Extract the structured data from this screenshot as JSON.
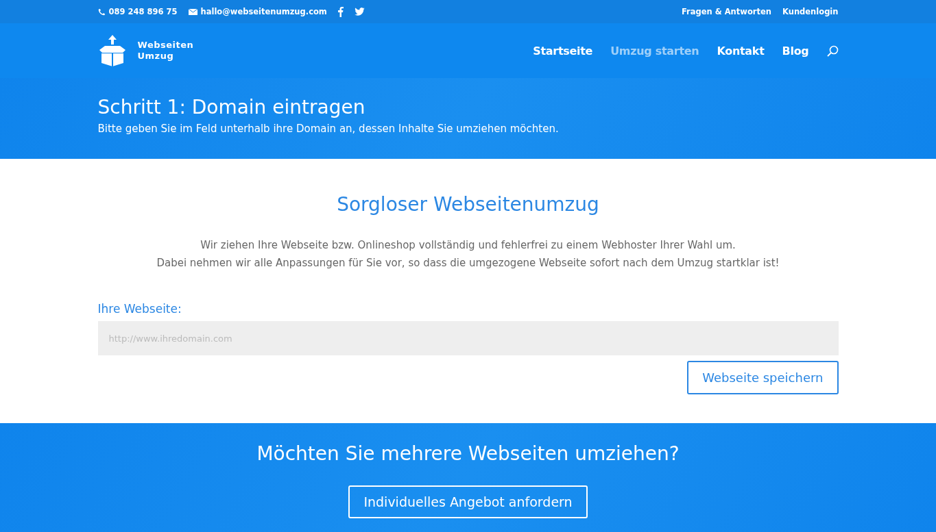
{
  "top_bar": {
    "phone": "089 248 896 75",
    "email": "hallo@webseitenumzug.com",
    "links": [
      "Fragen & Antworten",
      "Kundenlogin"
    ]
  },
  "header": {
    "logo_text": [
      "Webseiten",
      "Umzug"
    ],
    "nav": [
      {
        "label": "Startseite",
        "selected": false
      },
      {
        "label": "Umzug starten",
        "selected": true
      },
      {
        "label": "Kontakt",
        "selected": false
      },
      {
        "label": "Blog",
        "selected": false
      }
    ]
  },
  "hero": {
    "title": "Schritt 1: Domain eintragen",
    "subtitle": "Bitte geben Sie im Feld unterhalb ihre Domain an, dessen Inhalte Sie umziehen möchten."
  },
  "main": {
    "heading": "Sorgloser Webseitenumzug",
    "paragraphs": [
      "Wir ziehen Ihre Webseite bzw. Onlineshop vollständig und fehlerfrei zu einem Webhoster Ihrer Wahl um.",
      "Dabei nehmen wir alle Anpassungen für Sie vor, so dass die umgezogene Webseite sofort nach dem Umzug startklar ist!"
    ],
    "field_label": "Ihre Webseite:",
    "placeholder": "http://www.ihredomain.com",
    "button": "Webseite speichern"
  },
  "cta": {
    "heading": "Möchten Sie mehrere Webseiten umziehen?",
    "button": "Individuelles Angebot anfordern"
  }
}
